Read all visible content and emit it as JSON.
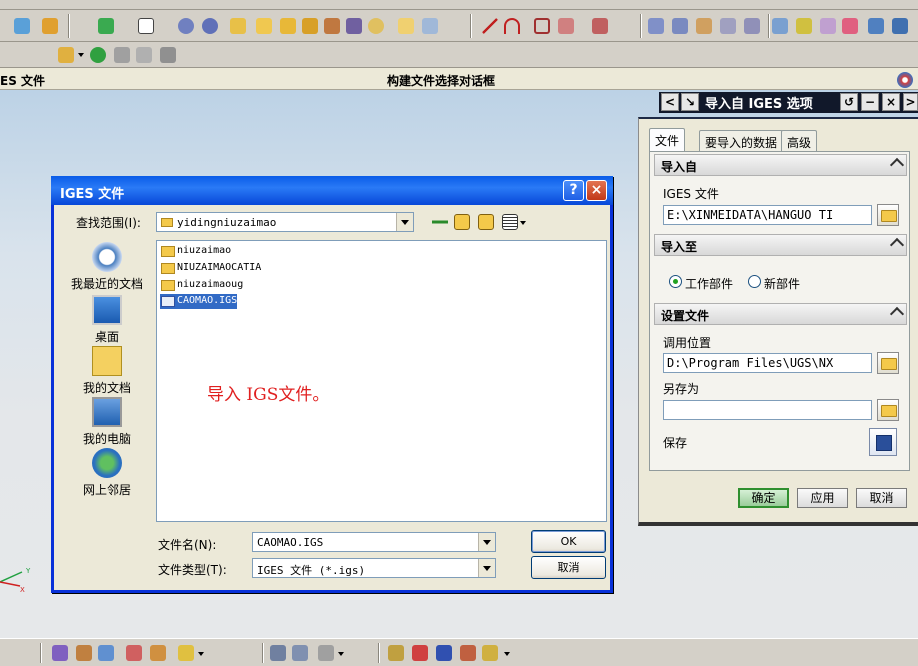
{
  "cue": {
    "left": "ES 文件",
    "center": "构建文件选择对话框"
  },
  "dialog": {
    "title": "IGES 文件",
    "help_btn": "?",
    "close_btn": "×",
    "lookin_label": "查找范围(I):",
    "lookin_value": "yidingniuzaimao",
    "places": [
      "我最近的文档",
      "桌面",
      "我的文档",
      "我的电脑",
      "网上邻居"
    ],
    "files": [
      {
        "name": "niuzaimao",
        "type": "folder",
        "selected": false
      },
      {
        "name": "NIUZAIMAOCATIA",
        "type": "folder",
        "selected": false
      },
      {
        "name": "niuzaimaoug",
        "type": "folder",
        "selected": false
      },
      {
        "name": "CAOMAO.IGS",
        "type": "igs",
        "selected": true
      }
    ],
    "annotation": "导入 IGS文件。",
    "filename_label": "文件名(N):",
    "filename_value": "CAOMAO.IGS",
    "filetype_label": "文件类型(T):",
    "filetype_value": "IGES 文件 (*.igs)",
    "ok_label": "OK",
    "cancel_label": "取消"
  },
  "panel": {
    "title": "导入自 IGES 选项",
    "tabs": [
      "文件",
      "要导入的数据",
      "高级"
    ],
    "active_tab": 0,
    "group_import_from": "导入自",
    "iges_file_label": "IGES 文件",
    "iges_file_value": "E:\\XINMEIDATA\\HANGUO TI",
    "group_import_to": "导入至",
    "radio_work_part": "工作部件",
    "radio_new_part": "新部件",
    "group_settings": "设置文件",
    "call_location_label": "调用位置",
    "call_location_value": "D:\\Program Files\\UGS\\NX",
    "save_as_label": "另存为",
    "save_as_value": "",
    "save_label": "保存",
    "ok_label": "确定",
    "apply_label": "应用",
    "cancel_label": "取消"
  },
  "colors": {
    "accent": "#0831d9",
    "annotation": "#e02020",
    "panel_header": "#11182a"
  }
}
